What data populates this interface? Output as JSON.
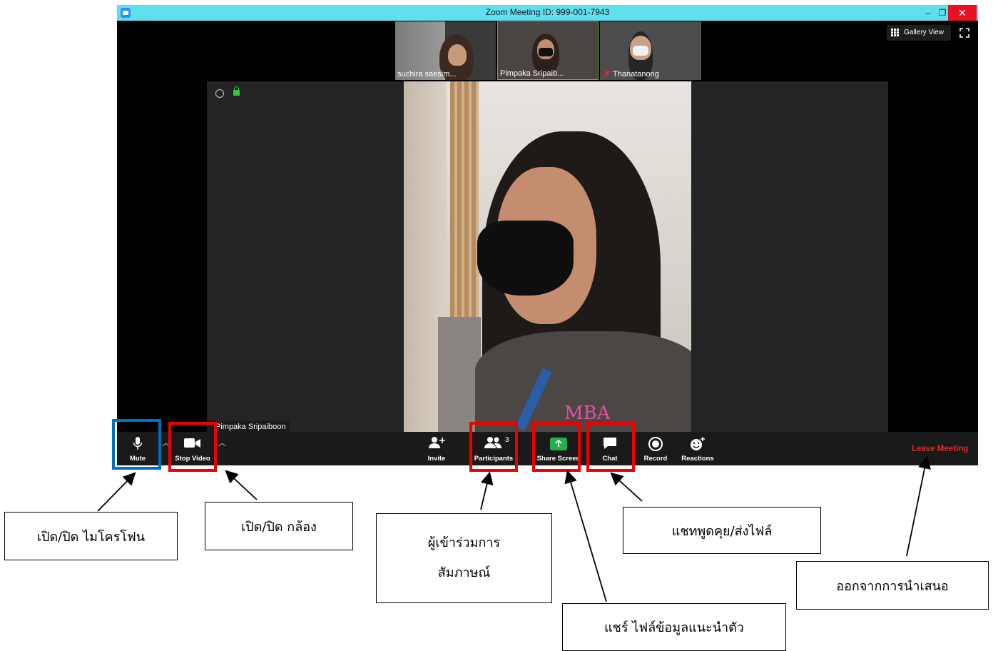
{
  "window": {
    "title": "Zoom Meeting ID: 999-001-7943",
    "minimize_glyph": "–",
    "restore_glyph": "❐",
    "close_glyph": "✕"
  },
  "thumbnails": [
    {
      "name": "suchira saesim...",
      "muted": false
    },
    {
      "name": "Pimpaka Sripaib...",
      "muted": false,
      "active": true
    },
    {
      "name": "Thanatanong",
      "muted": true
    }
  ],
  "view": {
    "gallery_label": "Gallery View"
  },
  "main_video": {
    "speaker": "Pimpaka Sripaiboon",
    "shirt_text": "MBA"
  },
  "toolbar": {
    "mute": "Mute",
    "stop_video": "Stop Video",
    "invite": "Invite",
    "participants": "Participants",
    "participants_count": "3",
    "share_screen": "Share Screen",
    "chat": "Chat",
    "record": "Record",
    "reactions": "Reactions",
    "leave": "Leave Meeting"
  },
  "annotations": {
    "mic": "เปิด/ปิด ไมโครโฟน",
    "camera": "เปิด/ปิด กล้อง",
    "participants_1": "ผู้เข้าร่วมการ",
    "participants_2": "สัมภาษณ์",
    "chat": "แชทพูดคุย/ส่งไฟล์",
    "share": "แชร์ ไฟล์ข้อมูลแนะนำตัว",
    "leave": "ออกจากการนำเสนอ"
  },
  "colors": {
    "titlebar": "#5fe0ec",
    "highlight_red": "#ee0000",
    "highlight_blue": "#0070c0",
    "leave_red": "#e02828",
    "share_green": "#23b14d"
  }
}
